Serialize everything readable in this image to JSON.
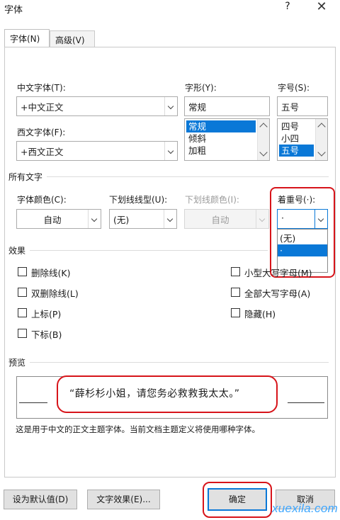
{
  "window": {
    "title": "字体",
    "help": "?",
    "close": "✕"
  },
  "tabs": [
    {
      "label": "字体(N)"
    },
    {
      "label": "高级(V)"
    }
  ],
  "font_section": {
    "chinese_font_label": "中文字体(T):",
    "chinese_font_value": "+中文正文",
    "western_font_label": "西文字体(F):",
    "western_font_value": "+西文正文",
    "style_label": "字形(Y):",
    "style_value": "常规",
    "style_list": [
      "常规",
      "倾斜",
      "加粗"
    ],
    "size_label": "字号(S):",
    "size_value": "五号",
    "size_list": [
      "四号",
      "小四",
      "五号"
    ]
  },
  "all_text": {
    "group_label": "所有文字",
    "font_color_label": "字体颜色(C):",
    "font_color_value": "自动",
    "underline_type_label": "下划线线型(U):",
    "underline_type_value": "(无)",
    "underline_color_label": "下划线颜色(I):",
    "underline_color_value": "自动",
    "emphasis_label": "着重号(·):",
    "emphasis_value": "·",
    "emphasis_options": [
      "(无)",
      "·"
    ]
  },
  "effects": {
    "group_label": "效果",
    "left": [
      {
        "label": "删除线(K)"
      },
      {
        "label": "双删除线(L)"
      },
      {
        "label": "上标(P)"
      },
      {
        "label": "下标(B)"
      }
    ],
    "right": [
      {
        "label": "小型大写字母(M)"
      },
      {
        "label": "全部大写字母(A)"
      },
      {
        "label": "隐藏(H)"
      }
    ]
  },
  "preview": {
    "group_label": "预览",
    "sample_text": "“薛杉杉小姐，请您务必救救我太太。”",
    "description": "这是用于中文的正文主题字体。当前文档主题定义将使用哪种字体。"
  },
  "buttons": {
    "set_default": "设为默认值(D)",
    "text_effects": "文字效果(E)...",
    "ok": "确定",
    "cancel": "取消"
  },
  "watermark": "xuexila.com",
  "colors": {
    "accent": "#0a78d7",
    "highlight_red": "#d7141a"
  }
}
